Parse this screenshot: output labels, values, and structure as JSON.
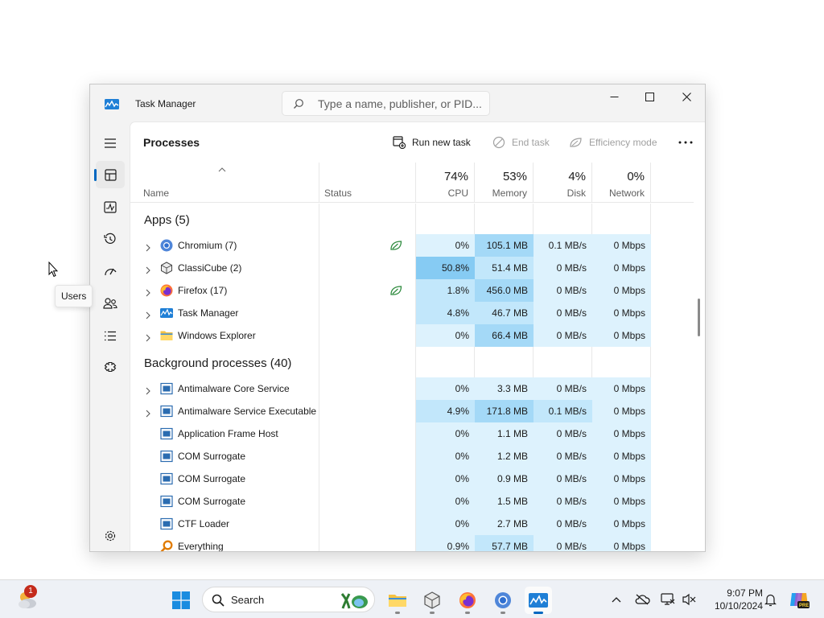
{
  "window": {
    "title": "Task Manager",
    "search_placeholder": "Type a name, publisher, or PID..."
  },
  "nav": {
    "items": [
      "menu-icon",
      "processes-icon",
      "performance-icon",
      "app-history-icon",
      "startup-apps-icon",
      "users-icon",
      "details-icon",
      "services-icon",
      "settings-icon"
    ],
    "active": "processes-icon",
    "tooltip": "Users"
  },
  "page": {
    "title": "Processes",
    "run_new_task": "Run new task",
    "end_task": "End task",
    "efficiency_mode": "Efficiency mode"
  },
  "columns": {
    "name": "Name",
    "status": "Status",
    "cpu": {
      "label": "CPU",
      "pct": "74%"
    },
    "memory": {
      "label": "Memory",
      "pct": "53%"
    },
    "disk": {
      "label": "Disk",
      "pct": "4%"
    },
    "network": {
      "label": "Network",
      "pct": "0%"
    }
  },
  "groups": [
    {
      "label": "Apps (5)",
      "rows": [
        {
          "name": "Chromium (7)",
          "icon": "chromium-icon",
          "expandable": true,
          "efficiency": true,
          "cpu": "0%",
          "mem": "105.1 MB",
          "disk": "0.1 MB/s",
          "net": "0 Mbps",
          "heat": [
            0,
            2,
            0,
            0
          ]
        },
        {
          "name": "ClassiCube (2)",
          "icon": "classicube-icon",
          "expandable": true,
          "efficiency": false,
          "cpu": "50.8%",
          "mem": "51.4 MB",
          "disk": "0 MB/s",
          "net": "0 Mbps",
          "heat": [
            3,
            1,
            0,
            0
          ]
        },
        {
          "name": "Firefox (17)",
          "icon": "firefox-icon",
          "expandable": true,
          "efficiency": true,
          "cpu": "1.8%",
          "mem": "456.0 MB",
          "disk": "0 MB/s",
          "net": "0 Mbps",
          "heat": [
            1,
            2,
            0,
            0
          ]
        },
        {
          "name": "Task Manager",
          "icon": "task-manager-icon",
          "expandable": true,
          "efficiency": false,
          "cpu": "4.8%",
          "mem": "46.7 MB",
          "disk": "0 MB/s",
          "net": "0 Mbps",
          "heat": [
            1,
            1,
            0,
            0
          ]
        },
        {
          "name": "Windows Explorer",
          "icon": "folder-icon",
          "expandable": true,
          "efficiency": false,
          "cpu": "0%",
          "mem": "66.4 MB",
          "disk": "0 MB/s",
          "net": "0 Mbps",
          "heat": [
            0,
            2,
            0,
            0
          ]
        }
      ]
    },
    {
      "label": "Background processes (40)",
      "rows": [
        {
          "name": "Antimalware Core Service",
          "icon": "service-icon",
          "expandable": true,
          "efficiency": false,
          "cpu": "0%",
          "mem": "3.3 MB",
          "disk": "0 MB/s",
          "net": "0 Mbps",
          "heat": [
            0,
            0,
            0,
            0
          ]
        },
        {
          "name": "Antimalware Service Executable",
          "icon": "service-icon",
          "expandable": true,
          "efficiency": false,
          "cpu": "4.9%",
          "mem": "171.8 MB",
          "disk": "0.1 MB/s",
          "net": "0 Mbps",
          "heat": [
            1,
            2,
            1,
            0
          ]
        },
        {
          "name": "Application Frame Host",
          "icon": "service-icon",
          "expandable": false,
          "efficiency": false,
          "cpu": "0%",
          "mem": "1.1 MB",
          "disk": "0 MB/s",
          "net": "0 Mbps",
          "heat": [
            0,
            0,
            0,
            0
          ]
        },
        {
          "name": "COM Surrogate",
          "icon": "service-icon",
          "expandable": false,
          "efficiency": false,
          "cpu": "0%",
          "mem": "1.2 MB",
          "disk": "0 MB/s",
          "net": "0 Mbps",
          "heat": [
            0,
            0,
            0,
            0
          ]
        },
        {
          "name": "COM Surrogate",
          "icon": "service-icon",
          "expandable": false,
          "efficiency": false,
          "cpu": "0%",
          "mem": "0.9 MB",
          "disk": "0 MB/s",
          "net": "0 Mbps",
          "heat": [
            0,
            0,
            0,
            0
          ]
        },
        {
          "name": "COM Surrogate",
          "icon": "service-icon",
          "expandable": false,
          "efficiency": false,
          "cpu": "0%",
          "mem": "1.5 MB",
          "disk": "0 MB/s",
          "net": "0 Mbps",
          "heat": [
            0,
            0,
            0,
            0
          ]
        },
        {
          "name": "CTF Loader",
          "icon": "service-icon",
          "expandable": false,
          "efficiency": false,
          "cpu": "0%",
          "mem": "2.7 MB",
          "disk": "0 MB/s",
          "net": "0 Mbps",
          "heat": [
            0,
            0,
            0,
            0
          ]
        },
        {
          "name": "Everything",
          "icon": "everything-icon",
          "expandable": false,
          "efficiency": false,
          "cpu": "0.9%",
          "mem": "57.7 MB",
          "disk": "0 MB/s",
          "net": "0 Mbps",
          "heat": [
            0,
            1,
            0,
            0
          ]
        }
      ]
    }
  ],
  "taskbar": {
    "weather_badge": "1",
    "search_label": "Search",
    "pinned": [
      "start-icon",
      "file-explorer-icon",
      "classicube-icon",
      "firefox-icon",
      "chromium-icon",
      "task-manager-icon"
    ],
    "active": "task-manager-icon",
    "time": "9:07 PM",
    "date": "10/10/2024"
  },
  "colors": {
    "accent": "#0067c0",
    "heat_levels": [
      "#ddf2fd",
      "#c2e7fb",
      "#a4d9f7",
      "#86cbf3"
    ],
    "efficiency_leaf": "#2e8b3e"
  }
}
